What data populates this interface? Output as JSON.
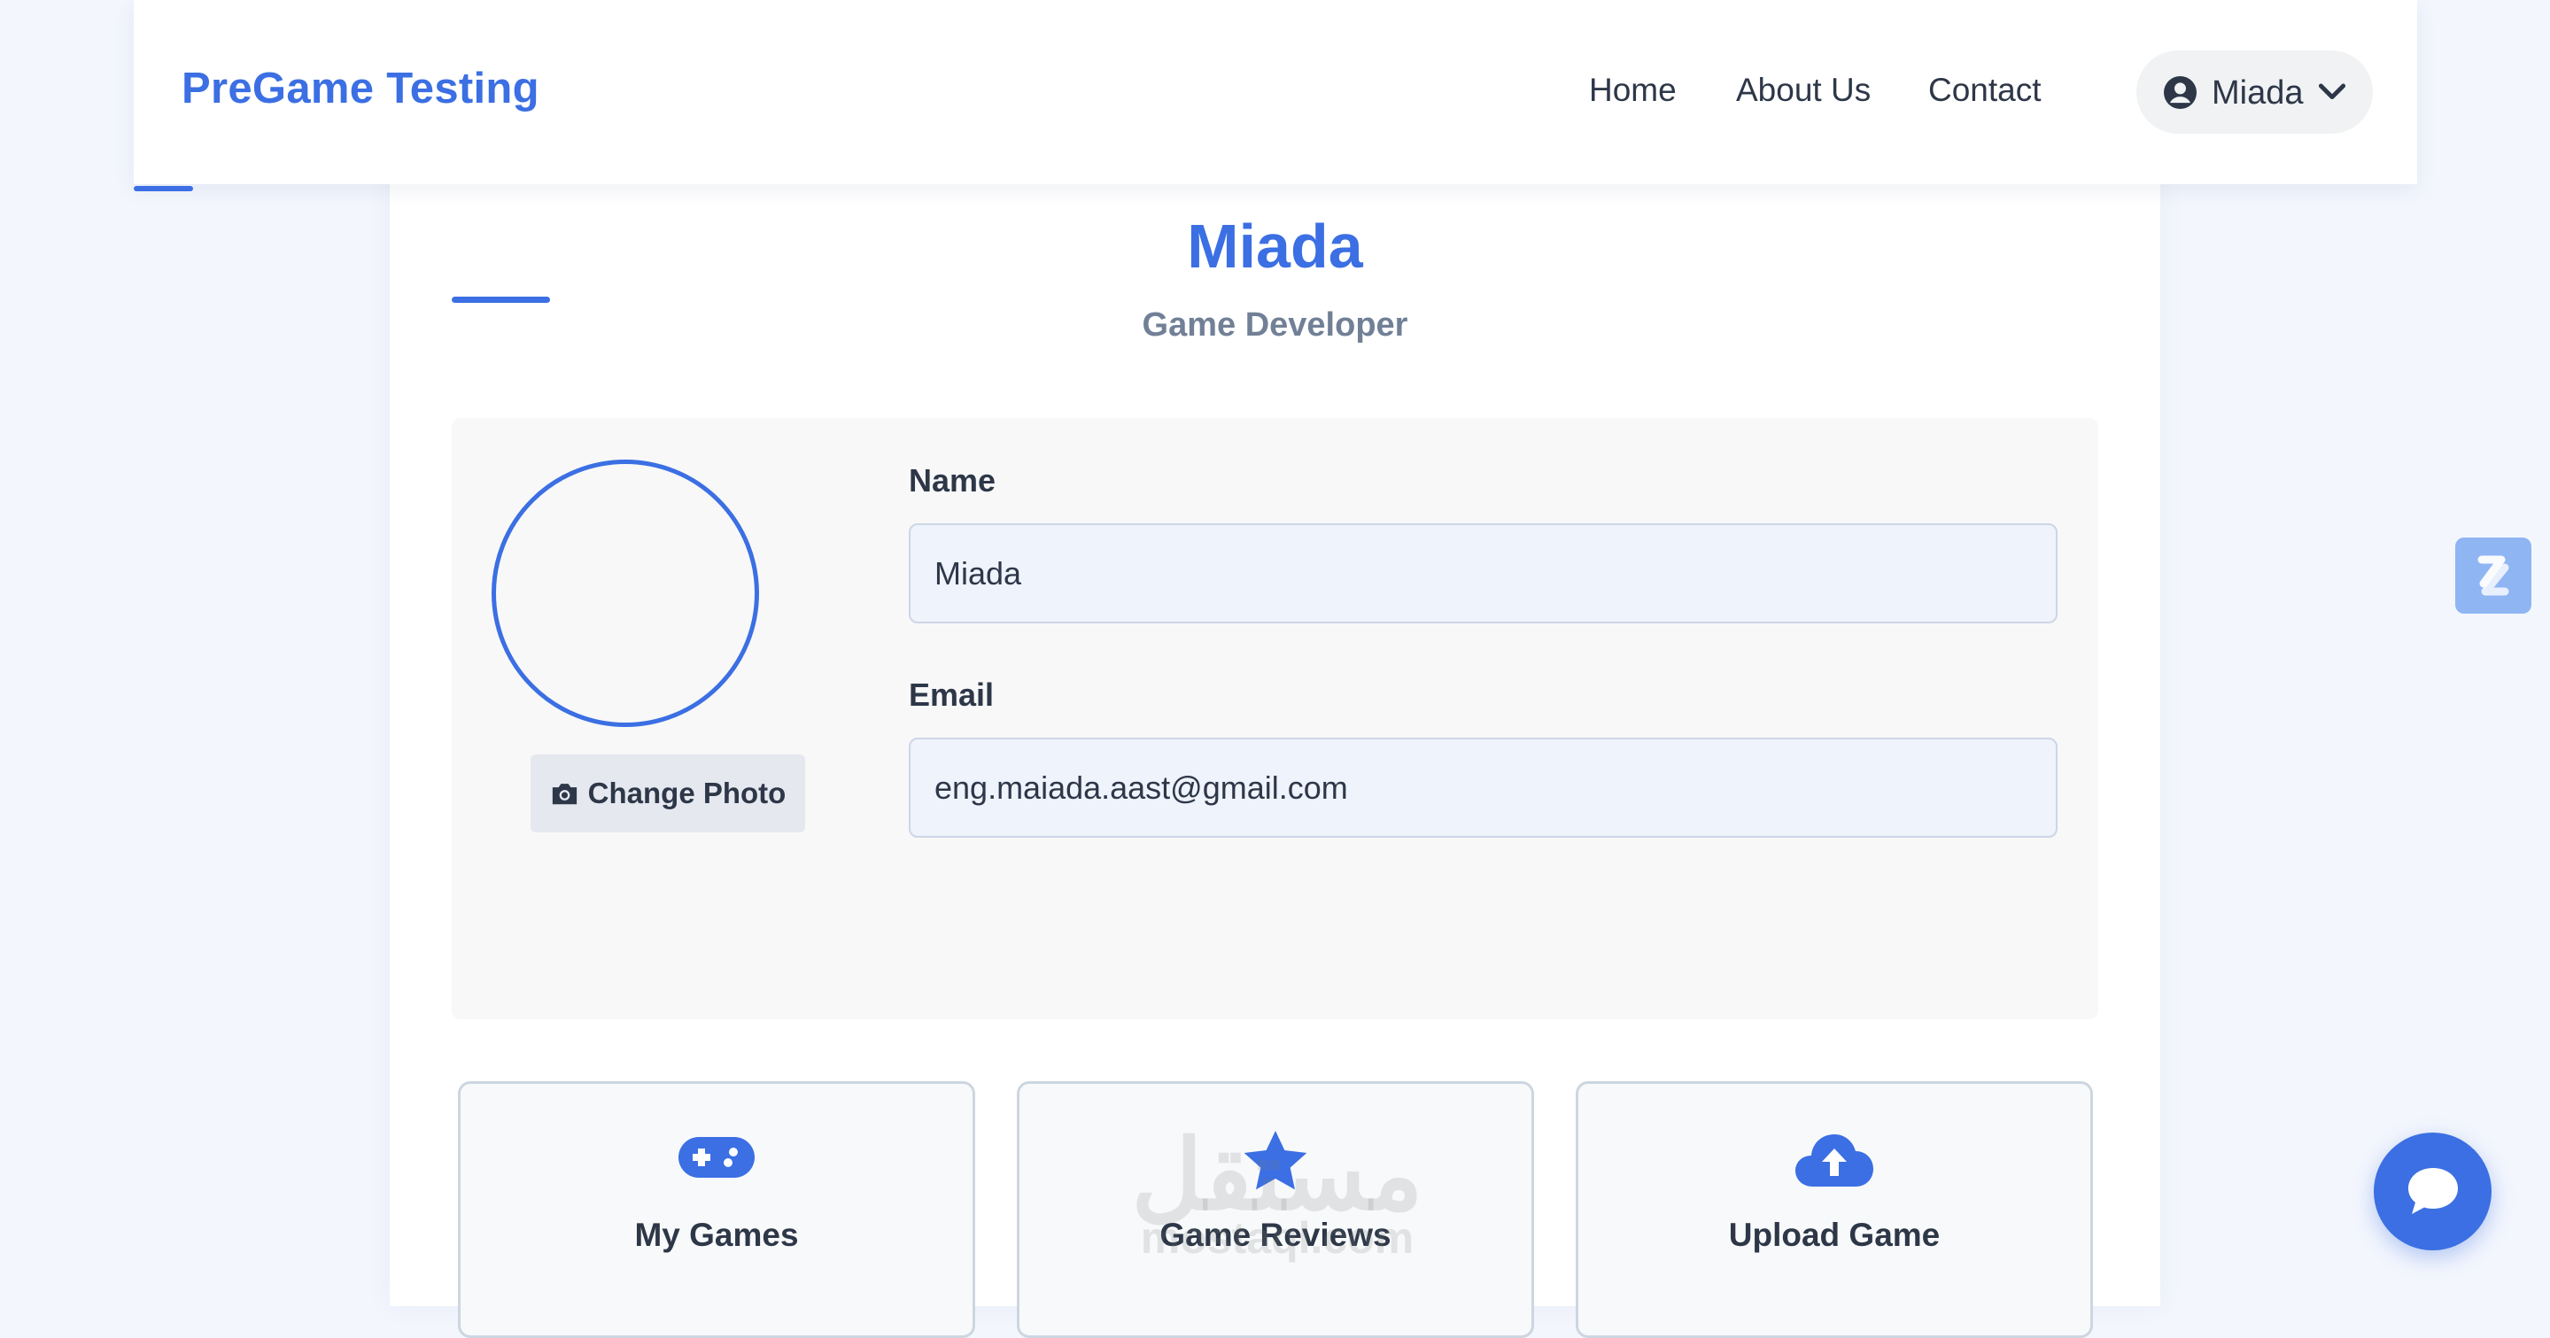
{
  "navbar": {
    "brand": "PreGame Testing",
    "links": [
      "Home",
      "About Us",
      "Contact"
    ],
    "user_name": "Miada",
    "user_icon": "user-circle-icon",
    "dropdown_icon": "chevron-down-icon"
  },
  "profile": {
    "name": "Miada",
    "role": "Game Developer",
    "change_photo_label": "Change Photo",
    "change_photo_icon": "camera-icon"
  },
  "form": {
    "name_label": "Name",
    "name_value": "Miada",
    "email_label": "Email",
    "email_value": "eng.maiada.aast@gmail.com"
  },
  "actions": [
    {
      "label": "My Games",
      "icon": "gamepad-icon"
    },
    {
      "label": "Game Reviews",
      "icon": "star-icon"
    },
    {
      "label": "Upload Game",
      "icon": "cloud-upload-icon"
    }
  ],
  "watermark": {
    "arabic": "مستقل",
    "latin": "mostaql.com"
  },
  "colors": {
    "accent": "#3b6fe3",
    "background": "#f3f6fd",
    "panel": "#f8f8f8",
    "input_bg": "#eef3fc"
  },
  "floating": {
    "chat_icon": "chat-bubble-icon",
    "side_widget_icon": "side-widget-icon"
  }
}
